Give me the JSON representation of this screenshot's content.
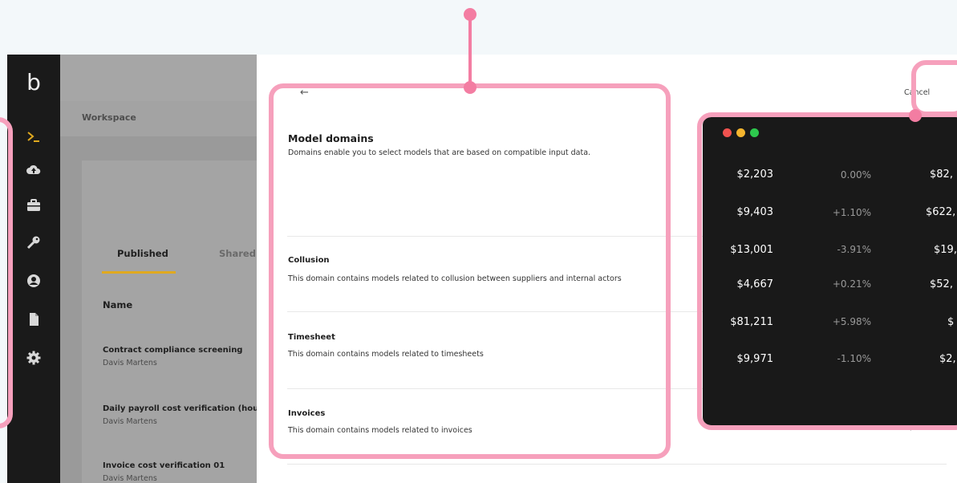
{
  "rail": {
    "logo": "b",
    "icons": [
      "terminal-icon",
      "cloud-upload-icon",
      "briefcase-icon",
      "key-icon",
      "user-icon",
      "document-icon",
      "gear-icon"
    ]
  },
  "workspace": {
    "breadcrumb": "Workspace",
    "tabs": [
      "Published",
      "Shared"
    ],
    "table_header": "Name",
    "rows": [
      {
        "title": "Contract compliance screening",
        "owner": "Davis Martens"
      },
      {
        "title": "Daily payroll cost verification (hourly w",
        "owner": "Davis Martens"
      },
      {
        "title": "Invoice cost verification 01",
        "owner": "Davis Martens"
      }
    ]
  },
  "modal": {
    "back": "←",
    "cancel": "Cancel",
    "title": "Model domains",
    "subtitle": "Domains enable you to select models that are based on compatible input data.",
    "domains": [
      {
        "name": "Collusion",
        "desc": "This domain contains models related to collusion between suppliers and internal actors"
      },
      {
        "name": "Timesheet",
        "desc": "This domain contains models related to timesheets"
      },
      {
        "name": "Invoices",
        "desc": "This domain contains models related to invoices"
      }
    ]
  },
  "terminal": {
    "rows": [
      {
        "value": "$2,203",
        "change": "0.00%",
        "third": "$82,"
      },
      {
        "value": "$9,403",
        "change": "+1.10%",
        "third": "$622,"
      },
      {
        "value": "$13,001",
        "change": "-3.91%",
        "third": "$19,"
      },
      {
        "value": "$4,667",
        "change": "+0.21%",
        "third": "$52,"
      },
      {
        "value": "$81,211",
        "change": "+5.98%",
        "third": "$"
      },
      {
        "value": "$9,971",
        "change": "-1.10%",
        "third": "$2,"
      }
    ]
  },
  "colors": {
    "highlight": "#f6a0bc",
    "highlight_dot": "#f37da2",
    "tab_active_underline": "#e0a91f",
    "terminal_bg": "#191919"
  }
}
